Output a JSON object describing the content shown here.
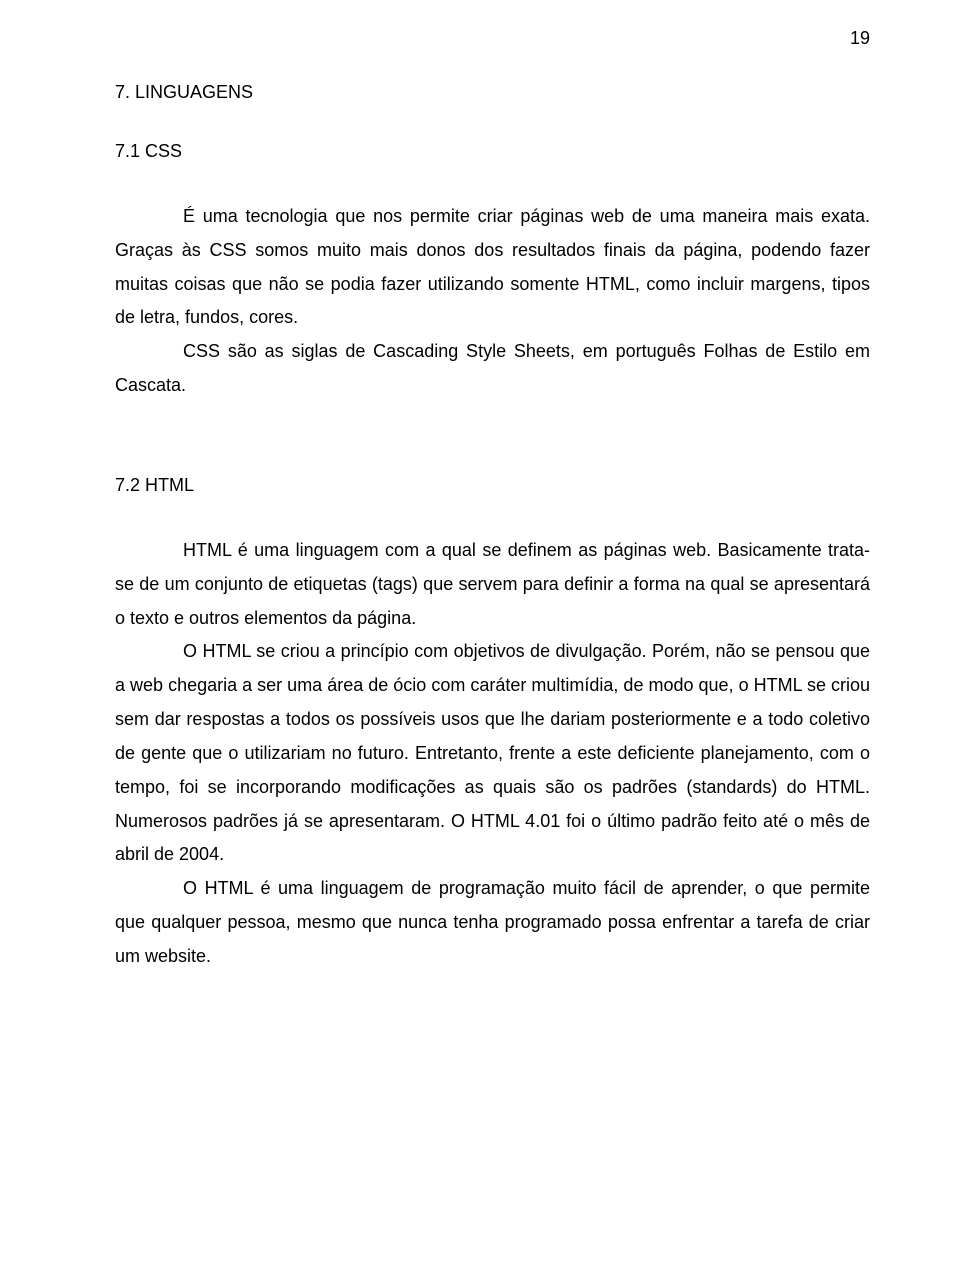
{
  "pageNumber": "19",
  "sections": [
    {
      "heading": "7. LINGUAGENS",
      "subheading": "7.1 CSS",
      "paragraphs": [
        "É uma tecnologia que nos permite criar páginas web de uma maneira mais exata. Graças às CSS somos muito mais donos dos resultados finais da página, podendo fazer muitas coisas que não se podia fazer utilizando somente HTML, como incluir margens, tipos de letra, fundos, cores.",
        "CSS são as siglas de Cascading Style Sheets, em português Folhas de Estilo em Cascata."
      ]
    },
    {
      "subheading": "7.2 HTML",
      "paragraphs": [
        "HTML é uma linguagem com a qual se definem as páginas web. Basicamente trata-se de um conjunto de etiquetas (tags) que servem para definir a forma na qual se apresentará o texto e outros elementos da página.",
        "O HTML se criou a princípio com objetivos de divulgação. Porém, não se pensou que a web chegaria a ser uma área de ócio com caráter multimídia, de modo que, o HTML se criou sem dar respostas a todos os possíveis usos que lhe dariam posteriormente e a todo coletivo de gente que o utilizariam no futuro. Entretanto, frente a este deficiente planejamento, com o tempo, foi se incorporando modificações as quais são os padrões (standards) do HTML. Numerosos padrões já se apresentaram. O HTML 4.01 foi o último padrão feito até o mês de abril de 2004.",
        "O HTML é uma linguagem de programação muito fácil de aprender, o que permite que qualquer pessoa, mesmo que nunca tenha programado possa enfrentar a tarefa de criar um website."
      ]
    }
  ]
}
